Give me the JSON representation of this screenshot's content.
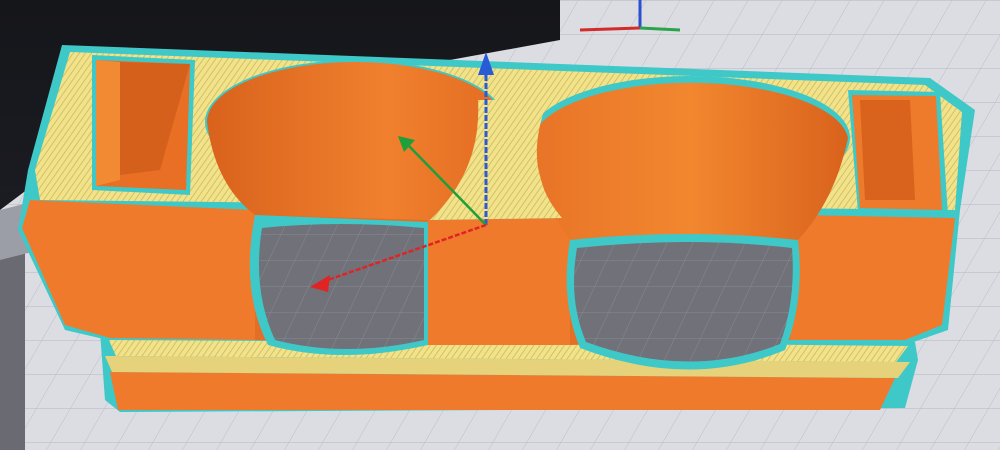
{
  "viewport": {
    "background": "#1d1d20",
    "build_plate_color": "#d9dbe2",
    "plate_grid_color": "#b9bcc6"
  },
  "model": {
    "name": "dual-cup-holder",
    "body_color": "#f07a2c",
    "shadow_color": "#d8611b",
    "infill_color": "#f2e28a",
    "outline_color": "#3fc8c8",
    "cutaway_floor_color": "#6e6f78"
  },
  "gizmo": {
    "x_axis_color": "#e02424",
    "y_axis_color": "#1f9e3a",
    "z_axis_color": "#2a5bd7"
  },
  "corner_axes": {
    "x_color": "#d22b2b",
    "y_color": "#2aa34a",
    "z_color": "#2a4fd0"
  }
}
